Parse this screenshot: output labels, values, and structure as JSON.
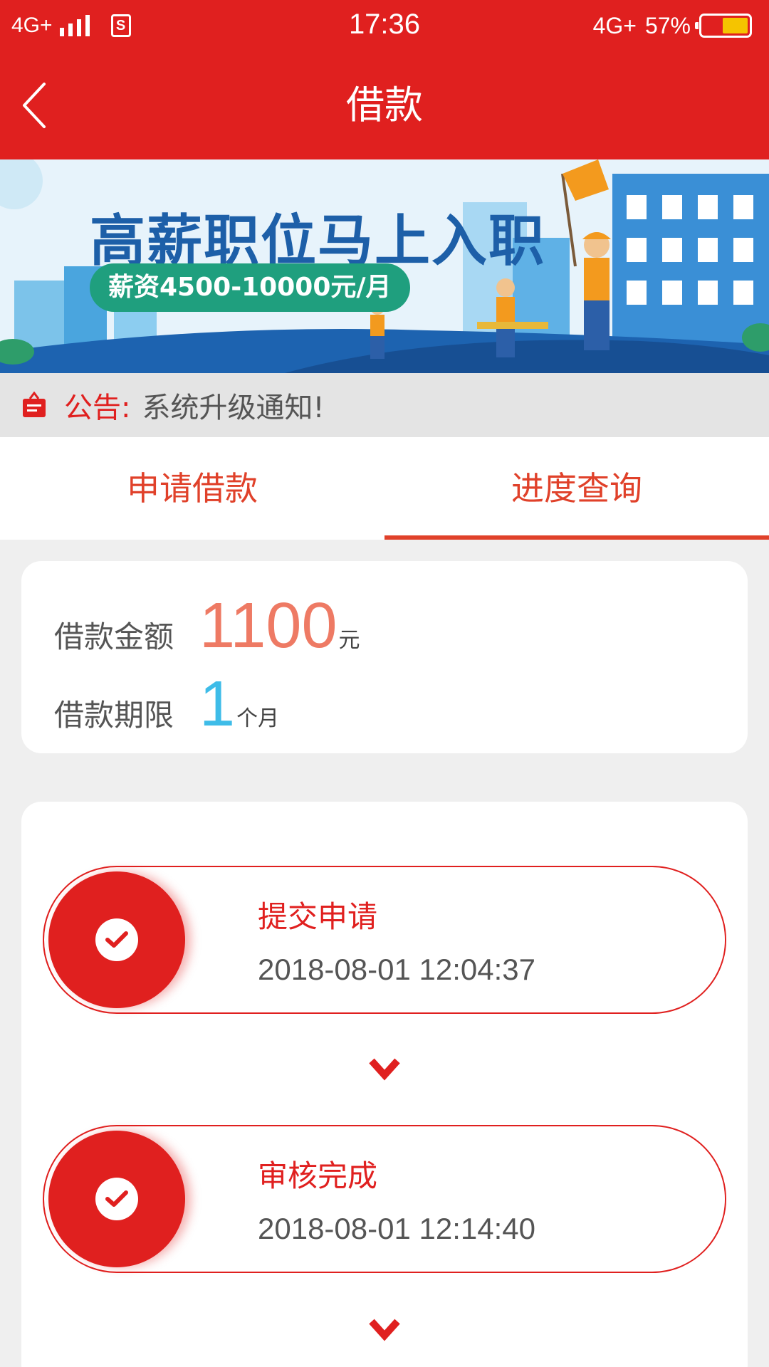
{
  "status_bar": {
    "network_left": "4G+",
    "sim_label": "S",
    "time": "17:36",
    "network_right": "4G+",
    "battery": "57%",
    "battery_level": 0.57
  },
  "header": {
    "title": "借款"
  },
  "banner": {
    "headline": "高薪职位马上入职",
    "salary": "薪资4500-10000元/月"
  },
  "notice": {
    "label": "公告:",
    "text": "系统升级通知!"
  },
  "tabs": [
    {
      "label": "申请借款",
      "active": false
    },
    {
      "label": "进度查询",
      "active": true
    }
  ],
  "loan": {
    "amount_label": "借款金额",
    "amount_value": "1100",
    "amount_unit": "元",
    "term_label": "借款期限",
    "term_value": "1",
    "term_unit": "个月"
  },
  "steps": [
    {
      "name": "提交申请",
      "time": "2018-08-01 12:04:37"
    },
    {
      "name": "审核完成",
      "time": "2018-08-01 12:14:40"
    }
  ],
  "colors": {
    "brand_red": "#e0201f",
    "amount": "#ee7a64",
    "term": "#3ebce8",
    "banner_pill": "#1f9f7e"
  }
}
